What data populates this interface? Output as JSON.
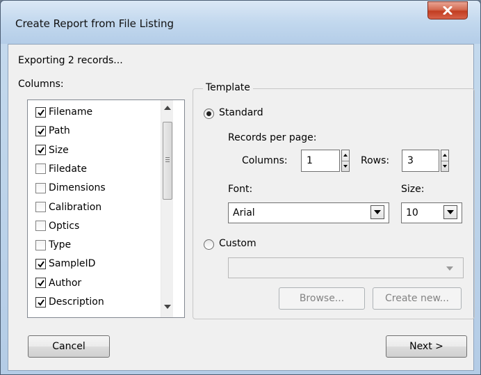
{
  "window": {
    "title": "Create Report from File Listing"
  },
  "status_text": "Exporting 2 records...",
  "columns": {
    "label": "Columns:",
    "items": [
      {
        "label": "Filename",
        "checked": true
      },
      {
        "label": "Path",
        "checked": true
      },
      {
        "label": "Size",
        "checked": true
      },
      {
        "label": "Filedate",
        "checked": false
      },
      {
        "label": "Dimensions",
        "checked": false
      },
      {
        "label": "Calibration",
        "checked": false
      },
      {
        "label": "Optics",
        "checked": false
      },
      {
        "label": "Type",
        "checked": false
      },
      {
        "label": "SampleID",
        "checked": true
      },
      {
        "label": "Author",
        "checked": true
      },
      {
        "label": "Description",
        "checked": true
      }
    ]
  },
  "template": {
    "title": "Template",
    "standard_label": "Standard",
    "standard_selected": true,
    "records_per_page_label": "Records per page:",
    "columns_label": "Columns:",
    "columns_value": "1",
    "rows_label": "Rows:",
    "rows_value": "3",
    "font_label": "Font:",
    "font_value": "Arial",
    "size_label": "Size:",
    "size_value": "10",
    "custom_label": "Custom",
    "custom_selected": false,
    "custom_value": "",
    "browse_label": "Browse...",
    "create_new_label": "Create new..."
  },
  "footer": {
    "cancel_label": "Cancel",
    "next_label": "Next >"
  }
}
